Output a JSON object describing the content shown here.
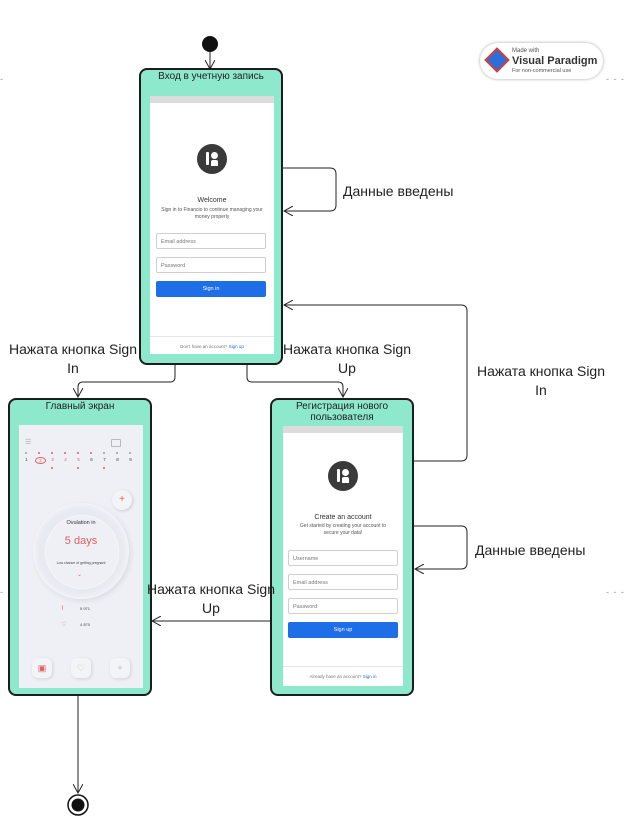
{
  "watermark": {
    "made_with": "Made with",
    "brand": "Visual Paradigm",
    "note": "For non-commercial use"
  },
  "states": {
    "login": {
      "title": "Вход в учетную запись",
      "welcome": "Welcome",
      "subtitle": "Sign in to Financio to continue managing your money properly",
      "email_placeholder": "Email address",
      "password_placeholder": "Password",
      "button": "Sign in",
      "footer_text": "Don't have an account?",
      "footer_link": "Sign up"
    },
    "main": {
      "title": "Главный экран",
      "calendar_days": [
        "1",
        "2",
        "3",
        "4",
        "5",
        "6",
        "7",
        "8",
        "9"
      ],
      "ovulation_label": "Ovulation in",
      "ovulation_value": "5 days",
      "chance_text": "Low chance of getting pregnant",
      "stat_1": "5 971",
      "stat_2": "4 870"
    },
    "register": {
      "title": "Регистрация нового пользователя",
      "heading": "Create an account",
      "subtitle": "Get started by creating your account to secure your data!",
      "username_placeholder": "Username",
      "email_placeholder": "Email address",
      "password_placeholder": "Password",
      "button": "Sign up",
      "footer_text": "Already have an account?",
      "footer_link": "Sign in"
    }
  },
  "transitions": {
    "login_self": "Данные введены",
    "login_to_main": "Нажата кнопка Sign In",
    "login_to_register": "Нажата кнопка Sign Up",
    "register_to_login": "Нажата кнопка Sign In",
    "register_self": "Данные введены",
    "register_to_main": "Нажата кнопка Sign Up"
  },
  "colors": {
    "state_fill": "#8de8cc",
    "button_blue": "#1e6ee8",
    "accent_red": "#e06060"
  }
}
